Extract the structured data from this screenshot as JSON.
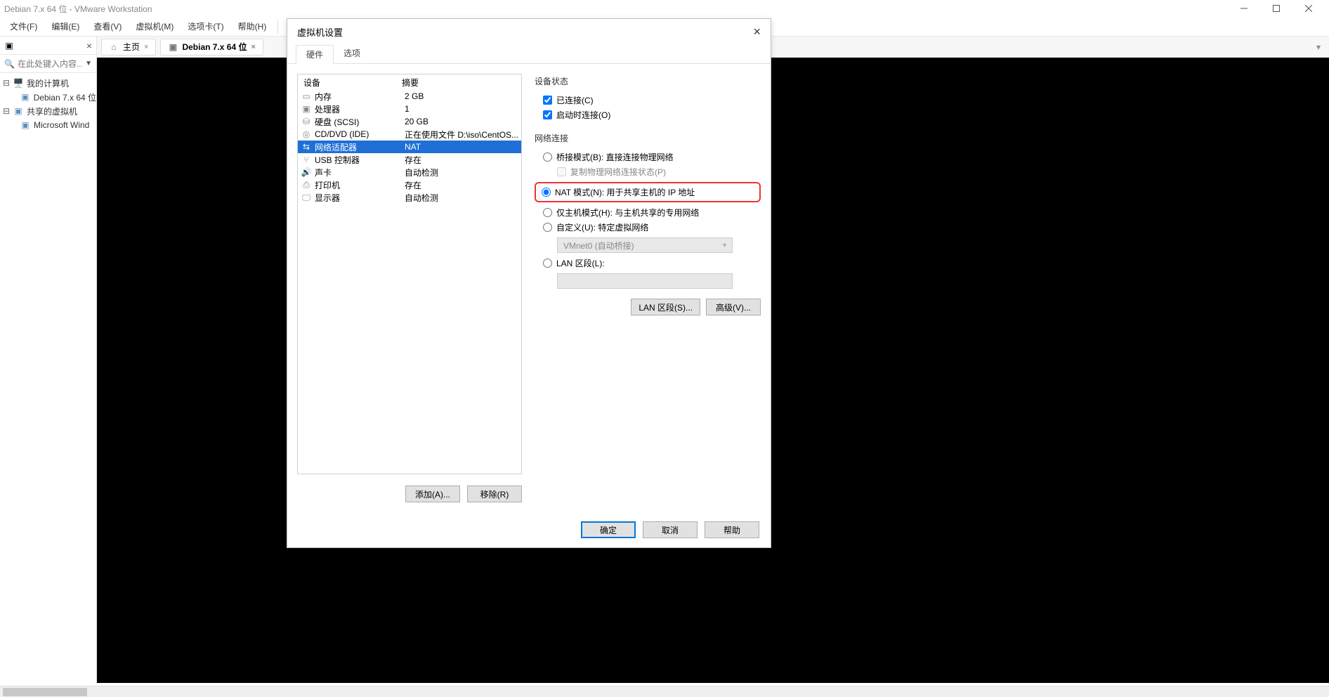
{
  "window": {
    "title": "Debian 7.x 64 位 - VMware Workstation"
  },
  "menu": {
    "file": "文件(F)",
    "edit": "编辑(E)",
    "view": "查看(V)",
    "vm": "虚拟机(M)",
    "tabs": "选项卡(T)",
    "help": "帮助(H)"
  },
  "sidebar": {
    "search_ph": "在此处键入内容...",
    "my_computer": "我的计算机",
    "vm0": "Debian 7.x 64 位",
    "shared": "共享的虚拟机",
    "vm1": "Microsoft Wind"
  },
  "tabs": {
    "home": "主页",
    "debian": "Debian 7.x 64 位"
  },
  "dialog": {
    "title": "虚拟机设置",
    "tab_hw": "硬件",
    "tab_opt": "选项",
    "col_dev": "设备",
    "col_sum": "摘要",
    "devices": [
      {
        "name": "内存",
        "summary": "2 GB",
        "icon": "memory"
      },
      {
        "name": "处理器",
        "summary": "1",
        "icon": "cpu"
      },
      {
        "name": "硬盘 (SCSI)",
        "summary": "20 GB",
        "icon": "hdd"
      },
      {
        "name": "CD/DVD (IDE)",
        "summary": "正在使用文件 D:\\iso\\CentOS...",
        "icon": "cd"
      },
      {
        "name": "网络适配器",
        "summary": "NAT",
        "icon": "net",
        "selected": true
      },
      {
        "name": "USB 控制器",
        "summary": "存在",
        "icon": "usb"
      },
      {
        "name": "声卡",
        "summary": "自动检测",
        "icon": "sound"
      },
      {
        "name": "打印机",
        "summary": "存在",
        "icon": "printer"
      },
      {
        "name": "显示器",
        "summary": "自动检测",
        "icon": "display"
      }
    ],
    "add_btn": "添加(A)...",
    "remove_btn": "移除(R)",
    "grp_state": "设备状态",
    "chk_connected": "已连接(C)",
    "chk_autoconnect": "启动时连接(O)",
    "grp_net": "网络连接",
    "rad_bridged": "桥接模式(B): 直接连接物理网络",
    "chk_replicate": "复制物理网络连接状态(P)",
    "rad_nat": "NAT 模式(N): 用于共享主机的 IP 地址",
    "rad_hostonly": "仅主机模式(H): 与主机共享的专用网络",
    "rad_custom": "自定义(U): 特定虚拟网络",
    "custom_sel": "VMnet0 (自动桥接)",
    "rad_lan": "LAN 区段(L):",
    "btn_lanseg": "LAN 区段(S)...",
    "btn_adv": "高级(V)...",
    "ok": "确定",
    "cancel": "取消",
    "help": "帮助"
  }
}
